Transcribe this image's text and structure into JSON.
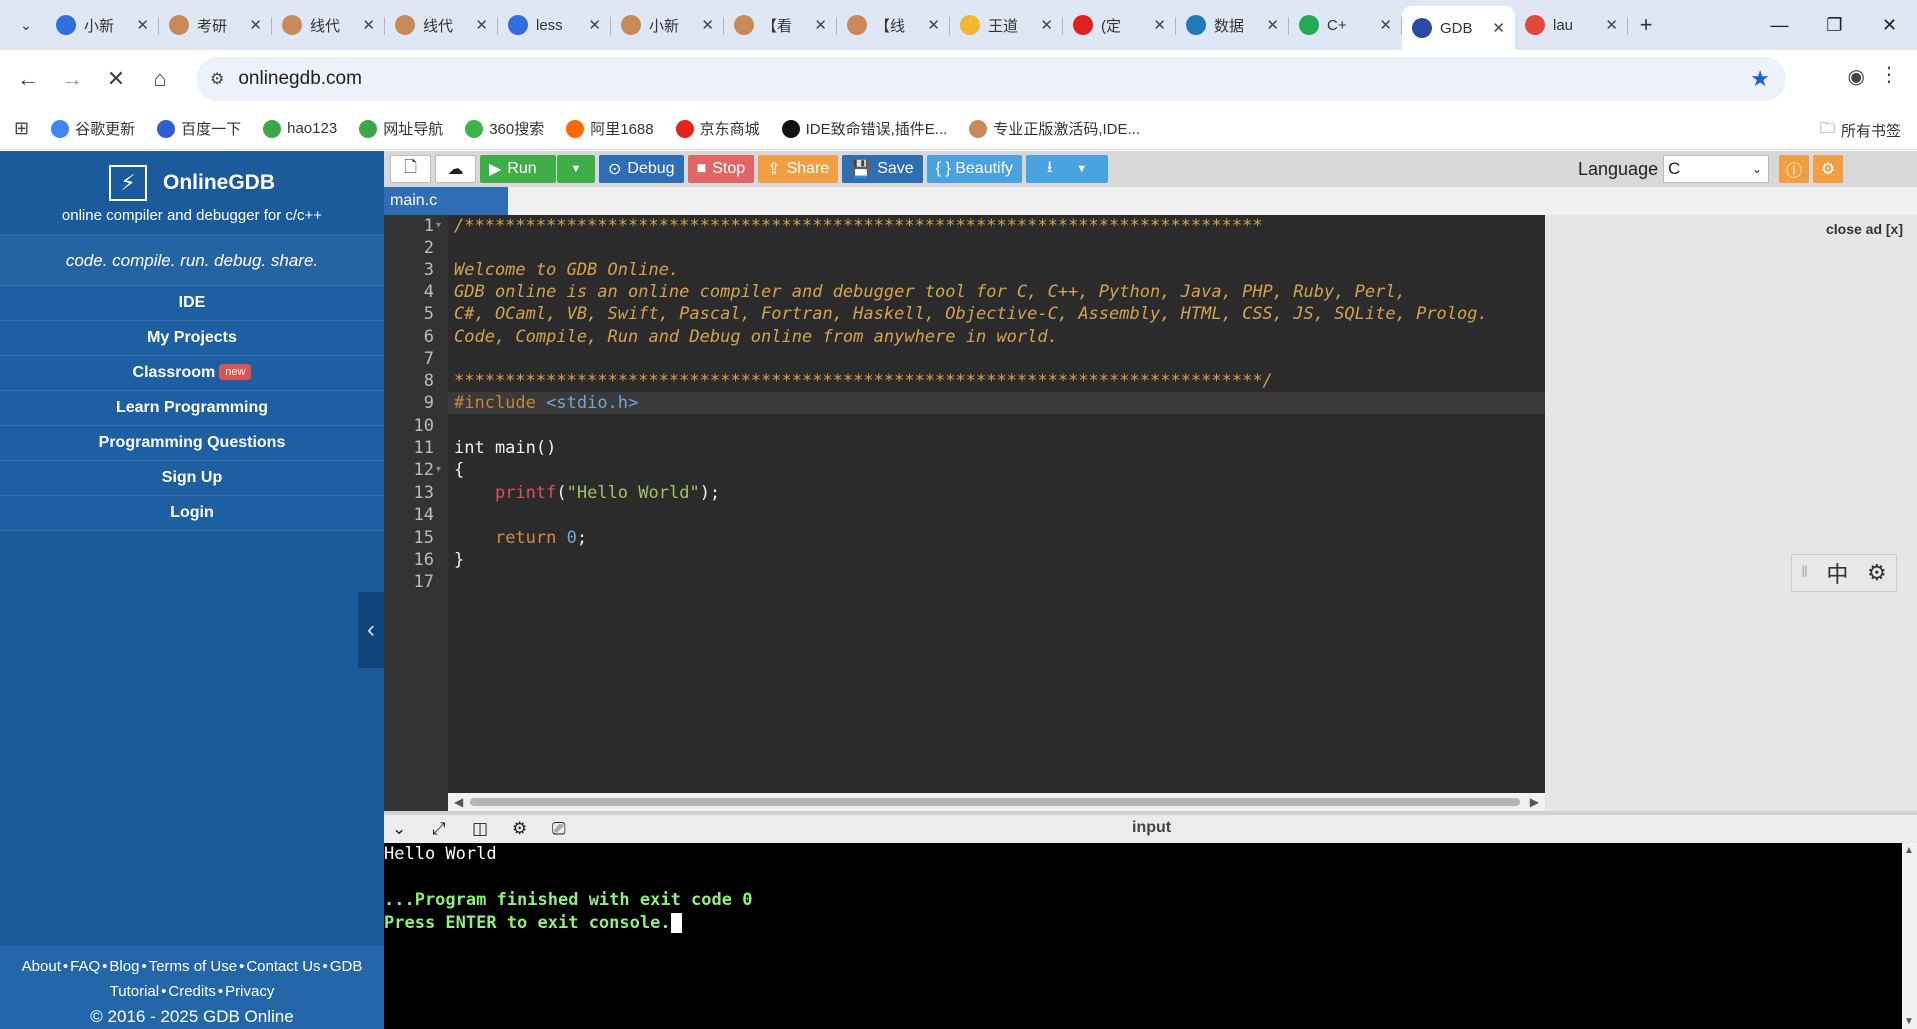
{
  "browser": {
    "tabs": [
      {
        "title": "小新",
        "color": "#2f6fde"
      },
      {
        "title": "考研",
        "color": "#c98a5a"
      },
      {
        "title": "线代",
        "color": "#c98a5a"
      },
      {
        "title": "线代",
        "color": "#c98a5a"
      },
      {
        "title": "less",
        "color": "#2f6fde"
      },
      {
        "title": "小新",
        "color": "#c98a5a"
      },
      {
        "title": "【看",
        "color": "#c98a5a"
      },
      {
        "title": "【线",
        "color": "#c98a5a"
      },
      {
        "title": "王道",
        "color": "#f2b832"
      },
      {
        "title": "(定",
        "color": "#e02020"
      },
      {
        "title": "数据",
        "color": "#1f7ab8"
      },
      {
        "title": "C+",
        "color": "#22aa55"
      },
      {
        "title": "GDB",
        "color": "#2b4aa0"
      },
      {
        "title": "lau",
        "color": "#e04a3a"
      }
    ],
    "url": "onlinegdb.com",
    "bookmarks": [
      {
        "label": "谷歌更新",
        "color": "#4285f4"
      },
      {
        "label": "百度一下",
        "color": "#2f5fd8"
      },
      {
        "label": "hao123",
        "color": "#3aa84a"
      },
      {
        "label": "网址导航",
        "color": "#3aa84a"
      },
      {
        "label": "360搜索",
        "color": "#3cb54a"
      },
      {
        "label": "阿里1688",
        "color": "#ff6a00"
      },
      {
        "label": "京东商城",
        "color": "#e1251b"
      },
      {
        "label": "IDE致命错误,插件E...",
        "color": "#111111"
      },
      {
        "label": "专业正版激活码,IDE...",
        "color": "#c98a5a"
      }
    ],
    "all_bookmarks": "所有书签"
  },
  "sidebar": {
    "brand": "OnlineGDB",
    "subtitle": "online compiler and debugger for c/c++",
    "tagline": "code. compile. run. debug. share.",
    "menu": [
      "IDE",
      "My Projects",
      "Classroom",
      "Learn Programming",
      "Programming Questions",
      "Sign Up",
      "Login"
    ],
    "new_badge": "new",
    "footer_links": [
      "About",
      "FAQ",
      "Blog",
      "Terms of Use",
      "Contact Us",
      "GDB"
    ],
    "footer_links2": [
      "Tutorial",
      "Credits",
      "Privacy"
    ],
    "copyright": "© 2016 - 2025 GDB Online"
  },
  "toolbar": {
    "run": "Run",
    "debug": "Debug",
    "stop": "Stop",
    "share": "Share",
    "save": "Save",
    "beautify": "{ } Beautify",
    "language_label": "Language",
    "language_value": "C"
  },
  "editor": {
    "file_tab": "main.c",
    "line_numbers": [
      "1",
      "2",
      "3",
      "4",
      "5",
      "6",
      "7",
      "8",
      "9",
      "10",
      "11",
      "12",
      "13",
      "14",
      "15",
      "16",
      "17"
    ],
    "close_ad": "close ad [x]"
  },
  "console": {
    "input_label": "input",
    "output": "Hello World",
    "finished": "...Program finished with exit code 0",
    "press_enter": "Press ENTER to exit console."
  },
  "ime": {
    "lang": "中"
  }
}
